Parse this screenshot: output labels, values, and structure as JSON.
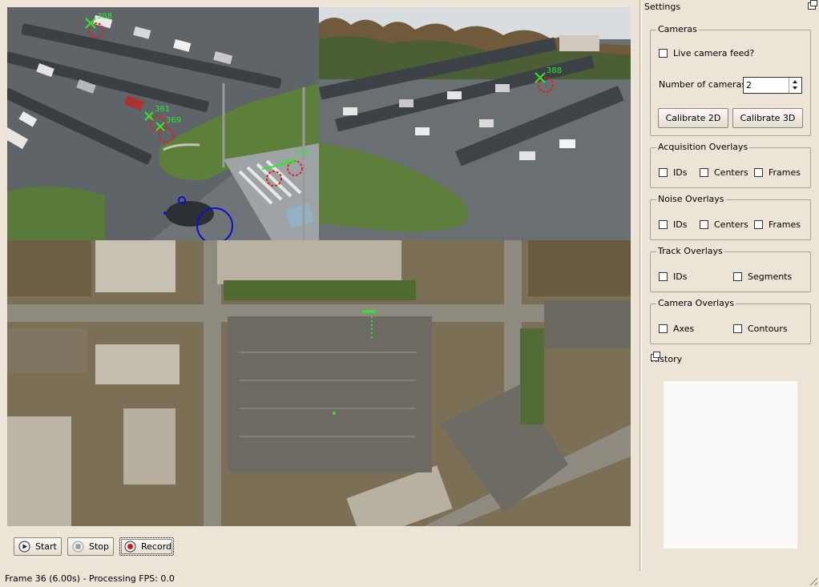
{
  "views": {
    "cam1": {
      "labels": [
        "388",
        "361",
        "369",
        "376",
        "378"
      ]
    },
    "cam2": {
      "labels": [
        "388"
      ]
    }
  },
  "controls": {
    "start_label": "Start",
    "stop_label": "Stop",
    "record_label": "Record"
  },
  "status": {
    "text": "Frame 36 (6.00s) - Processing FPS: 0.0"
  },
  "settings": {
    "title": "Settings",
    "cameras": {
      "title": "Cameras",
      "live_feed_label": "Live camera feed?",
      "num_cameras_label": "Number of cameras",
      "num_cameras_value": "2",
      "calibrate_2d_label": "Calibrate 2D",
      "calibrate_3d_label": "Calibrate 3D"
    },
    "acquisition_overlays": {
      "title": "Acquisition Overlays",
      "ids": "IDs",
      "centers": "Centers",
      "frames": "Frames"
    },
    "noise_overlays": {
      "title": "Noise Overlays",
      "ids": "IDs",
      "centers": "Centers",
      "frames": "Frames"
    },
    "track_overlays": {
      "title": "Track Overlays",
      "ids": "IDs",
      "segments": "Segments"
    },
    "camera_overlays": {
      "title": "Camera Overlays",
      "axes": "Axes",
      "contours": "Contours"
    }
  },
  "history": {
    "title": "History"
  },
  "colors": {
    "background": "#ece4d6",
    "overlay_green": "#2ee82e",
    "overlay_red": "#e02020",
    "overlay_blue": "#1010c8"
  }
}
